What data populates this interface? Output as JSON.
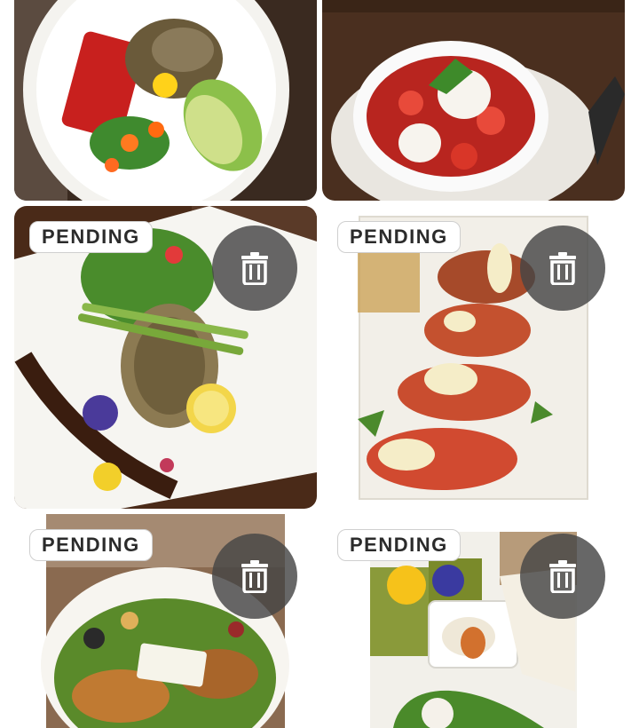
{
  "colors": {
    "badge_bg": "#ffffff",
    "badge_text": "#2b2b2b",
    "trash_bg": "#464646",
    "trash_icon": "#ffffff"
  },
  "gallery": {
    "items": [
      {
        "image": "salad-with-beet-and-avocado",
        "status": ""
      },
      {
        "image": "strawberry-and-burrata-bowl",
        "status": ""
      },
      {
        "image": "fish-with-asparagus-and-lemon",
        "status": "PENDING"
      },
      {
        "image": "bruschetta-platter",
        "status": "PENDING"
      },
      {
        "image": "chicken-salad-with-feta",
        "status": "PENDING"
      },
      {
        "image": "frittata-and-dip-platter",
        "status": "PENDING"
      }
    ]
  },
  "icons": {
    "delete": "trash-icon"
  }
}
